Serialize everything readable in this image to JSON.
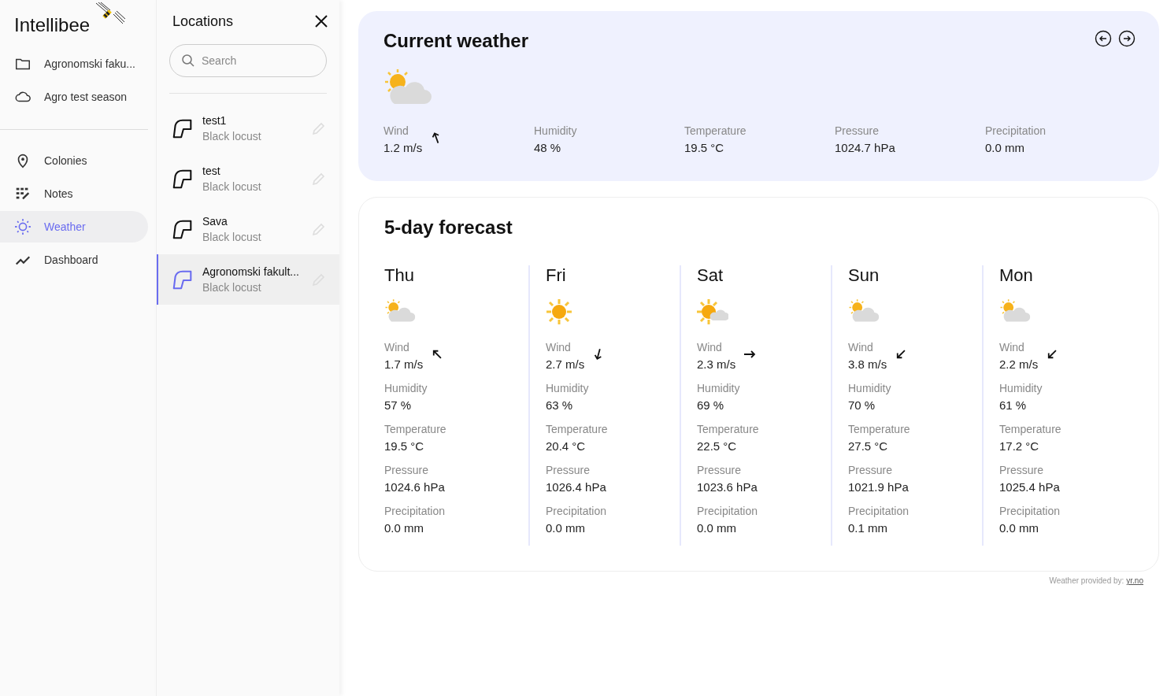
{
  "brand": {
    "name": "Intellibee"
  },
  "nav": {
    "top_items": [
      {
        "kind": "folder",
        "label": "Agronomski faku...",
        "selected": false
      },
      {
        "kind": "cloud",
        "label": "Agro test season",
        "selected": false
      }
    ],
    "items": [
      {
        "kind": "pin",
        "label": "Colonies",
        "selected": false
      },
      {
        "kind": "notes",
        "label": "Notes",
        "selected": false
      },
      {
        "kind": "sun",
        "label": "Weather",
        "selected": true
      },
      {
        "kind": "chart",
        "label": "Dashboard",
        "selected": false
      }
    ]
  },
  "locations": {
    "title": "Locations",
    "search": {
      "placeholder": "Search"
    },
    "items": [
      {
        "name": "test1",
        "crop": "Black locust",
        "selected": false
      },
      {
        "name": "test",
        "crop": "Black locust",
        "selected": false
      },
      {
        "name": "Sava",
        "crop": "Black locust",
        "selected": false
      },
      {
        "name": "Agronomski fakult...",
        "crop": "Black locust",
        "selected": true
      }
    ]
  },
  "current": {
    "title": "Current weather",
    "kind": "partlycloudy",
    "stats": [
      {
        "label": "Wind",
        "value": "1.2 m/s",
        "kind": "nnw"
      },
      {
        "label": "Humidity",
        "value": "48 %"
      },
      {
        "label": "Temperature",
        "value": "19.5 °C"
      },
      {
        "label": "Pressure",
        "value": "1024.7 hPa"
      },
      {
        "label": "Precipitation",
        "value": "0.0 mm"
      }
    ]
  },
  "forecast": {
    "title": "5-day forecast",
    "days": [
      {
        "day": "Thu",
        "kind": "partlycloudy",
        "stats": [
          {
            "label": "Wind",
            "value": "1.7 m/s",
            "kind": "nw"
          },
          {
            "label": "Humidity",
            "value": "57 %"
          },
          {
            "label": "Temperature",
            "value": "19.5 °C"
          },
          {
            "label": "Pressure",
            "value": "1024.6 hPa"
          },
          {
            "label": "Precipitation",
            "value": "0.0 mm"
          }
        ]
      },
      {
        "day": "Fri",
        "kind": "sunny",
        "stats": [
          {
            "label": "Wind",
            "value": "2.7 m/s",
            "kind": "ssw"
          },
          {
            "label": "Humidity",
            "value": "63 %"
          },
          {
            "label": "Temperature",
            "value": "20.4 °C"
          },
          {
            "label": "Pressure",
            "value": "1026.4 hPa"
          },
          {
            "label": "Precipitation",
            "value": "0.0 mm"
          }
        ]
      },
      {
        "day": "Sat",
        "kind": "fair",
        "stats": [
          {
            "label": "Wind",
            "value": "2.3 m/s",
            "kind": "e"
          },
          {
            "label": "Humidity",
            "value": "69 %"
          },
          {
            "label": "Temperature",
            "value": "22.5 °C"
          },
          {
            "label": "Pressure",
            "value": "1023.6 hPa"
          },
          {
            "label": "Precipitation",
            "value": "0.0 mm"
          }
        ]
      },
      {
        "day": "Sun",
        "kind": "partlycloudy",
        "stats": [
          {
            "label": "Wind",
            "value": "3.8 m/s",
            "kind": "sw"
          },
          {
            "label": "Humidity",
            "value": "70 %"
          },
          {
            "label": "Temperature",
            "value": "27.5 °C"
          },
          {
            "label": "Pressure",
            "value": "1021.9 hPa"
          },
          {
            "label": "Precipitation",
            "value": "0.1 mm"
          }
        ]
      },
      {
        "day": "Mon",
        "kind": "partlycloudy",
        "stats": [
          {
            "label": "Wind",
            "value": "2.2 m/s",
            "kind": "sw"
          },
          {
            "label": "Humidity",
            "value": "61 %"
          },
          {
            "label": "Temperature",
            "value": "17.2 °C"
          },
          {
            "label": "Pressure",
            "value": "1025.4 hPa"
          },
          {
            "label": "Precipitation",
            "value": "0.0 mm"
          }
        ]
      }
    ]
  },
  "credit": {
    "text": "Weather provided by:",
    "link": "yr.no"
  }
}
